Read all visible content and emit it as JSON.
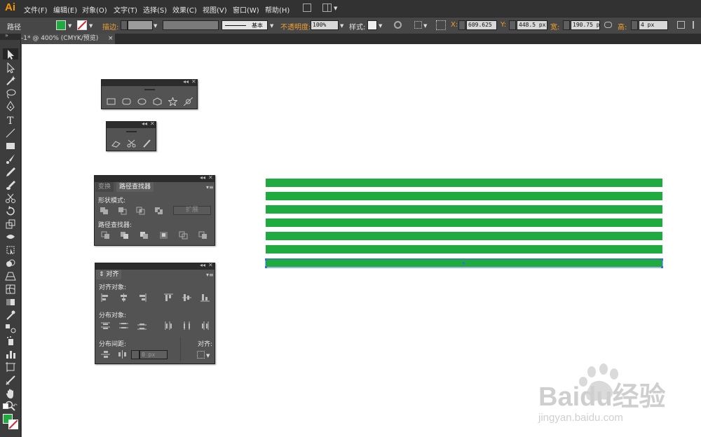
{
  "app": {
    "logo": "Ai"
  },
  "menu": [
    "文件(F)",
    "编辑(E)",
    "对象(O)",
    "文字(T)",
    "选择(S)",
    "效果(C)",
    "视图(V)",
    "窗口(W)",
    "帮助(H)"
  ],
  "control_bar": {
    "selection_label": "路径",
    "stroke_label": "描边:",
    "stroke_profile": "基本",
    "opacity_label": "不透明度:",
    "opacity_value": "100%",
    "style_label": "样式:",
    "x_label": "X:",
    "x_value": "609.625",
    "y_label": "Y:",
    "y_value": "448.5 px",
    "w_label": "宽:",
    "w_value": "190.75 px",
    "h_label": "高:",
    "h_value": "4 px",
    "fill_color": "#1fab3f"
  },
  "document_tab": {
    "title": "-1* @ 400% (CMYK/预览)",
    "close": "×"
  },
  "tools": [
    "selection-tool",
    "direct-selection-tool",
    "magic-wand-tool",
    "lasso-tool",
    "pen-tool",
    "type-tool",
    "line-tool",
    "rectangle-tool",
    "paintbrush-tool",
    "pencil-tool",
    "blob-brush-tool",
    "scissors-tool",
    "rotate-tool",
    "scale-tool",
    "width-tool",
    "free-transform-tool",
    "shape-builder-tool",
    "perspective-grid-tool",
    "mesh-tool",
    "gradient-tool",
    "eyedropper-tool",
    "blend-tool",
    "symbol-sprayer-tool",
    "column-graph-tool",
    "artboard-tool",
    "slice-tool",
    "hand-tool",
    "zoom-tool"
  ],
  "panels": {
    "shapes": {
      "icons": [
        "rectangle-icon",
        "rounded-rectangle-icon",
        "ellipse-icon",
        "polygon-icon",
        "star-icon",
        "flare-icon"
      ]
    },
    "erasers": {
      "icons": [
        "eraser-icon",
        "scissors-icon",
        "knife-icon"
      ]
    },
    "pathfinder": {
      "tab_inactive": "变换",
      "tab_active": "路径查找器",
      "shape_modes_label": "形状模式:",
      "expand_label": "扩展",
      "pathfinders_label": "路径查找器:"
    },
    "align": {
      "tab": "对齐",
      "align_objects_label": "对齐对象:",
      "distribute_objects_label": "分布对象:",
      "distribute_spacing_label": "分布间距:",
      "spacing_value": "0 px",
      "align_to_label": "对齐:"
    }
  },
  "canvas": {
    "stripe_count": 7,
    "stripe_color": "#1fab3f",
    "selection_color": "#3a6fd8"
  },
  "watermark": {
    "brand": "Baidu经验",
    "url": "jingyan.baidu.com"
  }
}
